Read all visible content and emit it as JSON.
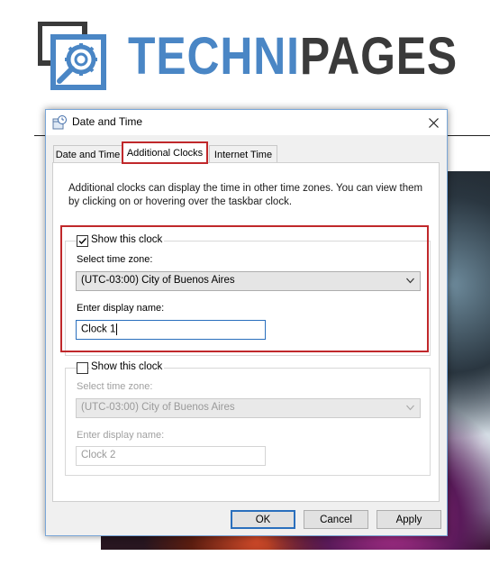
{
  "logo": {
    "part1": "TECHNI",
    "part2": "PAGES"
  },
  "dialog": {
    "title": "Date and Time",
    "tabs": [
      {
        "label": "Date and Time"
      },
      {
        "label": "Additional Clocks"
      },
      {
        "label": "Internet Time"
      }
    ],
    "description": "Additional clocks can display the time in other time zones. You can view them by clicking on or hovering over the taskbar clock.",
    "clock1": {
      "show_label": "Show this clock",
      "checked": true,
      "timezone_label": "Select time zone:",
      "timezone_value": "(UTC-03:00) City of Buenos Aires",
      "name_label": "Enter display name:",
      "name_value": "Clock 1"
    },
    "clock2": {
      "show_label": "Show this clock",
      "checked": false,
      "timezone_label": "Select time zone:",
      "timezone_value": "(UTC-03:00) City of Buenos Aires",
      "name_label": "Enter display name:",
      "name_value": "Clock 2"
    },
    "buttons": {
      "ok": "OK",
      "cancel": "Cancel",
      "apply": "Apply"
    }
  },
  "colors": {
    "brand_blue": "#4a86c5",
    "brand_dark": "#3a3a3a",
    "highlight_red": "#c0282b",
    "focus_blue": "#2a6fbd"
  },
  "icons": [
    "magnifier-gear-icon",
    "clock-icon",
    "close-icon",
    "checkmark-icon",
    "chevron-down-icon"
  ]
}
